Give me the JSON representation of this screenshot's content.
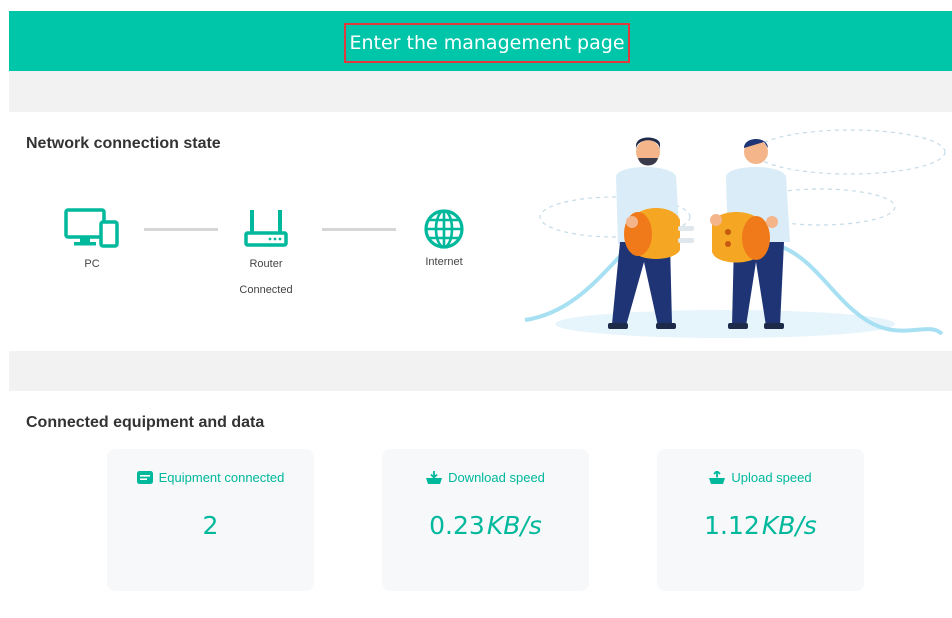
{
  "header": {
    "manage_label": "Enter the management page"
  },
  "network": {
    "title": "Network connection state",
    "pc_label": "PC",
    "router_label": "Router",
    "router_status": "Connected",
    "internet_label": "Internet"
  },
  "equipment": {
    "title": "Connected equipment and data",
    "cards": [
      {
        "label": "Equipment connected",
        "value": "2",
        "unit": "",
        "icon": "device-icon"
      },
      {
        "label": "Download speed",
        "value": "0.23",
        "unit": "KB/s",
        "icon": "download-icon"
      },
      {
        "label": "Upload speed",
        "value": "1.12",
        "unit": "KB/s",
        "icon": "upload-icon"
      }
    ]
  },
  "colors": {
    "accent": "#00c6a9",
    "highlight_border": "#e0393e",
    "band": "#f2f2f2"
  }
}
